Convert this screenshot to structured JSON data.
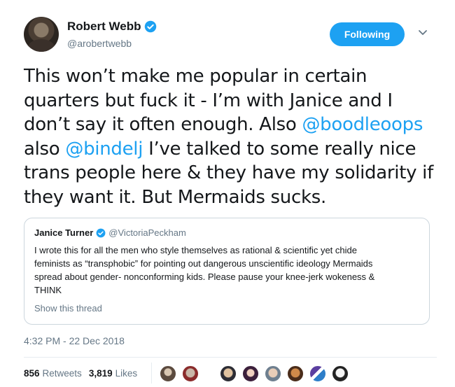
{
  "author": {
    "name": "Robert Webb",
    "handle": "@arobertwebb",
    "follow_label": "Following"
  },
  "tweet": {
    "line1": "This won’t make me popular in certain",
    "line2": "quarters but fuck it - I’m with Janice and I",
    "line3": "don’t say it often enough. Also ",
    "mention1": "@boodleoops",
    "line4_pre": "also ",
    "mention2": "@bindelj",
    "line4_post": " I’ve talked to some really nice",
    "line5": "trans people here & they have my solidarity if",
    "line6": "they want it. But Mermaids sucks."
  },
  "quote": {
    "name": "Janice Turner",
    "handle": "@VictoriaPeckham",
    "line1": "I wrote this for all the men who style themselves as rational & scientific yet chide",
    "line2": "feminists as “transphobic” for pointing out dangerous unscientific ideology Mermaids",
    "line3": "spread about gender- nonconforming kids. Please pause your knee-jerk wokeness &",
    "line4": "THINK",
    "show_thread": "Show this thread"
  },
  "timestamp": "4:32 PM - 22 Dec 2018",
  "stats": {
    "retweets_count": "856",
    "retweets_label": "Retweets",
    "likes_count": "3,819",
    "likes_label": "Likes"
  },
  "colors": {
    "accent": "#1da1f2",
    "muted": "#657786",
    "text": "#14171a",
    "border": "#ccd6dd"
  },
  "icons": {
    "verified": "verified-badge-icon",
    "caret": "chevron-down-icon"
  }
}
